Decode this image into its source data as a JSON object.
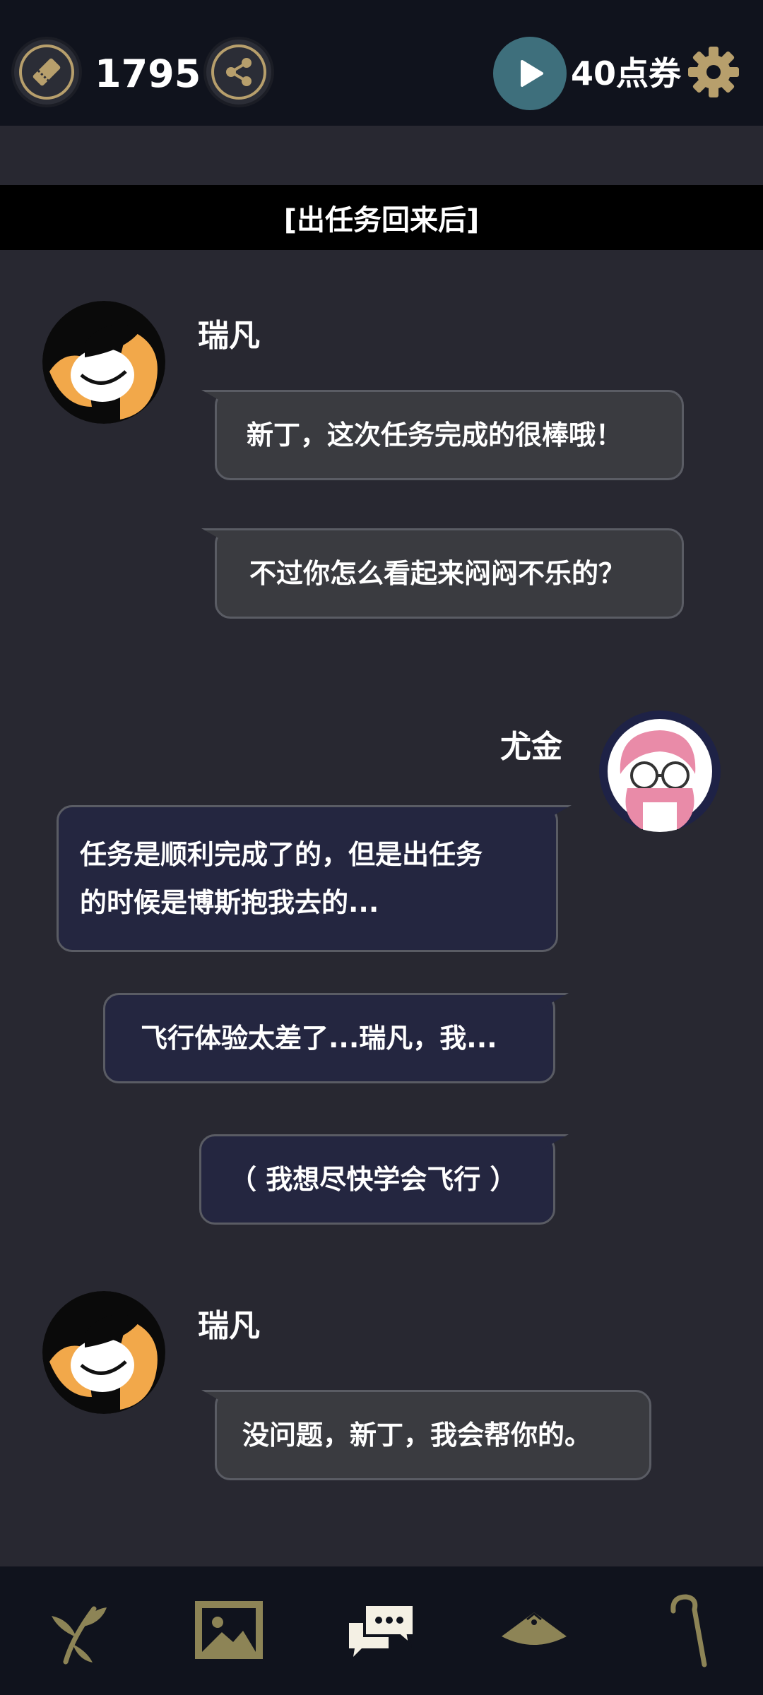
{
  "header": {
    "ticket_count": "1795",
    "voucher_label": "40点券",
    "icons": [
      "ticket-icon",
      "share-icon",
      "play-icon",
      "gear-icon"
    ]
  },
  "scene": {
    "label": "[出任务回来后]"
  },
  "messages": [
    {
      "speaker": "瑞凡",
      "lines": [
        "新丁，这次任务完成的很棒哦！",
        "不过你怎么看起来闷闷不乐的？"
      ]
    },
    {
      "speaker": "尤金",
      "lines": [
        "任务是顺利完成了的，但是出任务的时候是博斯抱我去的...",
        "飞行体验太差了...瑞凡，我...",
        "（ 我想尽快学会飞行 ）"
      ]
    },
    {
      "speaker": "瑞凡",
      "lines": [
        "没问题，新丁，我会帮你的。"
      ]
    }
  ],
  "message_text": {
    "m1_a": "新丁，这次任务完成的很棒哦！",
    "m1_b": "不过你怎么看起来闷闷不乐的？",
    "m2_a_line1": "任务是顺利完成了的，但是出任务",
    "m2_a_line2": "的时候是博斯抱我去的...",
    "m2_b": "飞行体验太差了...瑞凡，我...",
    "m2_c": "（ 我想尽快学会飞行 ）",
    "m3_a": "没问题，新丁，我会帮你的。"
  },
  "bottom_nav": {
    "items": [
      "branch-icon",
      "gallery-icon",
      "chat-icon",
      "hat-icon",
      "cane-icon"
    ],
    "active": "chat-icon"
  },
  "colors": {
    "bar_bg": "#10131d",
    "page_bg": "#282831",
    "gold": "#b79f6c",
    "bubble_grey": "#3a3b40",
    "bubble_navy": "#242640",
    "play_teal": "#3e6f7c"
  }
}
